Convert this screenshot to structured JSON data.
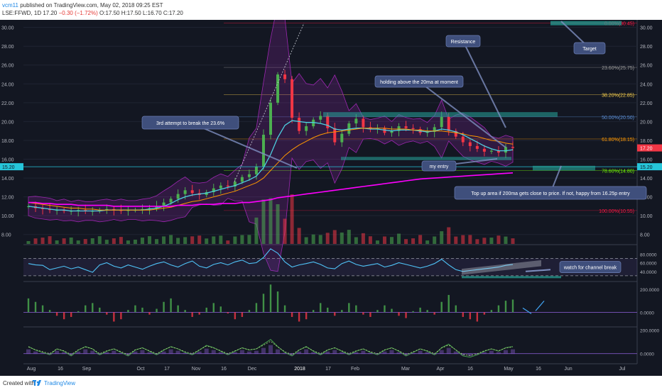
{
  "header": {
    "user": "vcm11",
    "published": "published on TradingView.com, May 02, 2018 09:25 EST",
    "symbol": "LSE:FFWD, 1D",
    "last": "17.20",
    "change": "−0.30 (−1.72%)",
    "ohlc": "O:17.50 H:17.50 L:16.70 C:17.20"
  },
  "footer": {
    "created_with": "Created with",
    "brand": "TradingView"
  },
  "colors": {
    "bg": "#131722",
    "up": "#4caf50",
    "down": "#f23645",
    "ma200": "#ff00ff",
    "ma20": "#4dd0e1",
    "ma50": "#ff9800",
    "bb": "#9c27b0",
    "zone": "#26a69a",
    "note": "#3f4f7c"
  },
  "chart_data": [
    {
      "type": "candlestick",
      "title": "",
      "ylim": [
        7,
        30.5
      ],
      "y_ticks": [
        "30.00",
        "28.00",
        "26.00",
        "24.00",
        "22.00",
        "20.00",
        "18.00",
        "16.00",
        "14.00",
        "12.00",
        "10.00",
        "8.00"
      ],
      "x_ticks": [
        "Aug",
        "16",
        "Sep",
        "Oct",
        "17",
        "Nov",
        "16",
        "Dec",
        "2018",
        "17",
        "Feb",
        "Mar",
        "Apr",
        "16",
        "May",
        "16",
        "Jun",
        "Jul"
      ],
      "last_price": "17.20",
      "level_marker": "15.20",
      "fib_levels": [
        {
          "label": "0.00%(30.45)",
          "value": 30.45,
          "color": "#ff1744"
        },
        {
          "label": "23.60%(25.75)",
          "value": 25.75,
          "color": "#9e9e9e"
        },
        {
          "label": "38.20%(22.85)",
          "value": 22.85,
          "color": "#ffd54f"
        },
        {
          "label": "50.00%(20.50)",
          "value": 20.5,
          "color": "#5c8fd6"
        },
        {
          "label": "61.80%(18.15)",
          "value": 18.15,
          "color": "#ff9800"
        },
        {
          "label": "78.60%(14.80)",
          "value": 14.8,
          "color": "#76ff03"
        },
        {
          "label": "100.00%(10.55)",
          "value": 10.55,
          "color": "#ff1744"
        }
      ],
      "series": [
        {
          "name": "",
          "kind": "close",
          "values": [
            11.0,
            10.8,
            10.7,
            10.6,
            10.6,
            10.5,
            10.5,
            10.6,
            10.5,
            10.5,
            10.6,
            10.7,
            10.6,
            10.5,
            10.6,
            10.6,
            10.7,
            10.8,
            11.0,
            11.4,
            11.8,
            12.3,
            12.7,
            12.4,
            12.2,
            12.5,
            12.9,
            13.2,
            13.1,
            13.6,
            14.1,
            14.4,
            15.2,
            18.6,
            22.0,
            25.0,
            24.5,
            20.4,
            19.0,
            19.5,
            20.2,
            20.6,
            19.3,
            17.8,
            18.7,
            19.8,
            20.3,
            19.4,
            19.2,
            19.3,
            18.8,
            19.0,
            19.5,
            19.3,
            19.2,
            18.8,
            18.9,
            19.4,
            20.5,
            19.0,
            18.4,
            17.8,
            17.4,
            17.1,
            16.8,
            16.9,
            16.7,
            17.3,
            17.2
          ]
        },
        {
          "name": "",
          "kind": "ma20",
          "values": [
            11.0,
            10.9,
            10.8,
            10.7,
            10.6,
            10.6,
            10.5,
            10.5,
            10.5,
            10.5,
            10.5,
            10.6,
            10.6,
            10.6,
            10.6,
            10.6,
            10.6,
            10.7,
            10.8,
            11.0,
            11.3,
            11.7,
            12.0,
            12.2,
            12.3,
            12.4,
            12.6,
            12.8,
            13.0,
            13.2,
            13.5,
            13.8,
            14.2,
            15.1,
            16.5,
            18.3,
            19.6,
            20.1,
            20.0,
            19.9,
            19.9,
            19.8,
            19.6,
            19.2,
            19.1,
            19.2,
            19.3,
            19.3,
            19.2,
            19.2,
            19.1,
            19.0,
            19.1,
            19.1,
            19.1,
            19.0,
            18.9,
            19.0,
            19.2,
            19.1,
            18.9,
            18.6,
            18.2,
            17.8,
            17.4,
            17.1,
            16.9,
            16.9,
            17.0
          ]
        },
        {
          "name": "",
          "kind": "ma50",
          "values": [
            11.4,
            11.3,
            11.2,
            11.1,
            11.0,
            10.9,
            10.8,
            10.8,
            10.7,
            10.7,
            10.6,
            10.6,
            10.6,
            10.6,
            10.6,
            10.6,
            10.6,
            10.6,
            10.7,
            10.8,
            10.9,
            11.1,
            11.3,
            11.5,
            11.6,
            11.8,
            12.0,
            12.2,
            12.4,
            12.6,
            12.9,
            13.2,
            13.5,
            14.0,
            14.8,
            15.6,
            16.4,
            17.0,
            17.5,
            17.9,
            18.3,
            18.6,
            18.8,
            18.9,
            19.0,
            19.1,
            19.2,
            19.3,
            19.3,
            19.3,
            19.3,
            19.2,
            19.2,
            19.2,
            19.1,
            19.1,
            19.0,
            19.0,
            19.0,
            18.9,
            18.8,
            18.7,
            18.5,
            18.4,
            18.2,
            18.0,
            17.9,
            17.7,
            17.6
          ]
        },
        {
          "name": "",
          "kind": "ma200",
          "values": [
            11.4,
            11.4,
            11.3,
            11.3,
            11.2,
            11.2,
            11.2,
            11.1,
            11.1,
            11.1,
            11.1,
            11.1,
            11.0,
            11.0,
            11.0,
            11.0,
            11.0,
            11.0,
            11.0,
            11.0,
            11.0,
            11.1,
            11.1,
            11.1,
            11.2,
            11.2,
            11.2,
            11.3,
            11.3,
            11.3,
            11.4,
            11.4,
            11.5,
            11.6,
            11.7,
            11.9,
            12.0,
            12.1,
            12.2,
            12.3,
            12.4,
            12.5,
            12.6,
            12.7,
            12.8,
            12.9,
            13.0,
            13.1,
            13.2,
            13.3,
            13.4,
            13.5,
            13.6,
            13.7,
            13.8,
            13.9,
            13.95,
            14.0,
            14.05,
            14.1,
            14.15,
            14.2,
            14.25,
            14.3,
            14.35,
            14.4,
            14.45,
            14.5,
            14.55
          ]
        }
      ],
      "annotations": [
        {
          "text": "3rd attempt to break the 23.6%"
        },
        {
          "text": "Resistance"
        },
        {
          "text": "Target"
        },
        {
          "text": "holding above the 20ma at moment"
        },
        {
          "text": "my entry"
        },
        {
          "text": "Top up area if 200ma gets close to price. If not, happy from 16.25p entry"
        }
      ]
    },
    {
      "type": "line",
      "ylim": [
        20,
        100
      ],
      "y_ticks": [
        "80.0000",
        "60.0000",
        "40.0000"
      ],
      "series": [
        {
          "name": "",
          "values": [
            58,
            55,
            54,
            44,
            48,
            52,
            46,
            50,
            44,
            38,
            55,
            60,
            52,
            48,
            55,
            50,
            45,
            52,
            58,
            62,
            55,
            50,
            58,
            64,
            52,
            48,
            56,
            60,
            55,
            62,
            66,
            58,
            60,
            72,
            92,
            82,
            62,
            50,
            55,
            58,
            62,
            56,
            48,
            46,
            58,
            64,
            56,
            52,
            55,
            58,
            50,
            54,
            60,
            56,
            52,
            48,
            52,
            58,
            68,
            55,
            44,
            40,
            42,
            44,
            46,
            48,
            50,
            54,
            56
          ]
        }
      ],
      "annotations": [
        {
          "text": "watch for channel break"
        }
      ]
    },
    {
      "type": "histogram",
      "ylim": [
        -120,
        260
      ],
      "y_ticks": [
        "200.0000",
        "0.0000"
      ],
      "values": [
        120,
        90,
        60,
        20,
        -30,
        -60,
        -40,
        10,
        60,
        80,
        40,
        -20,
        -80,
        -60,
        20,
        60,
        40,
        -20,
        30,
        90,
        120,
        60,
        20,
        -40,
        -20,
        40,
        80,
        50,
        -10,
        -60,
        -40,
        20,
        80,
        160,
        240,
        180,
        60,
        -40,
        -80,
        -60,
        20,
        80,
        40,
        -30,
        20,
        80,
        60,
        -20,
        -40,
        20,
        60,
        30,
        -30,
        -50,
        10,
        40,
        20,
        -20,
        90,
        150,
        60,
        -40,
        -60,
        -80,
        -20,
        20,
        60,
        100,
        110
      ]
    },
    {
      "type": "line",
      "ylim": [
        -80,
        220
      ],
      "y_ticks": [
        "200.0000",
        "0.0000"
      ],
      "series": [
        {
          "name": "",
          "values": [
            60,
            30,
            10,
            -10,
            40,
            20,
            -20,
            30,
            60,
            40,
            -10,
            20,
            40,
            10,
            -20,
            30,
            50,
            20,
            -10,
            30,
            60,
            40,
            10,
            -10,
            30,
            70,
            50,
            20,
            -10,
            20,
            50,
            30,
            40,
            80,
            120,
            60,
            10,
            -20,
            30,
            60,
            20,
            -10,
            30,
            50,
            20,
            -10,
            20,
            40,
            10,
            -10,
            30,
            50,
            20,
            -20,
            10,
            40,
            20,
            -10,
            50,
            80,
            30,
            -20,
            -30,
            -10,
            20,
            40,
            20,
            50,
            60
          ]
        }
      ]
    }
  ]
}
